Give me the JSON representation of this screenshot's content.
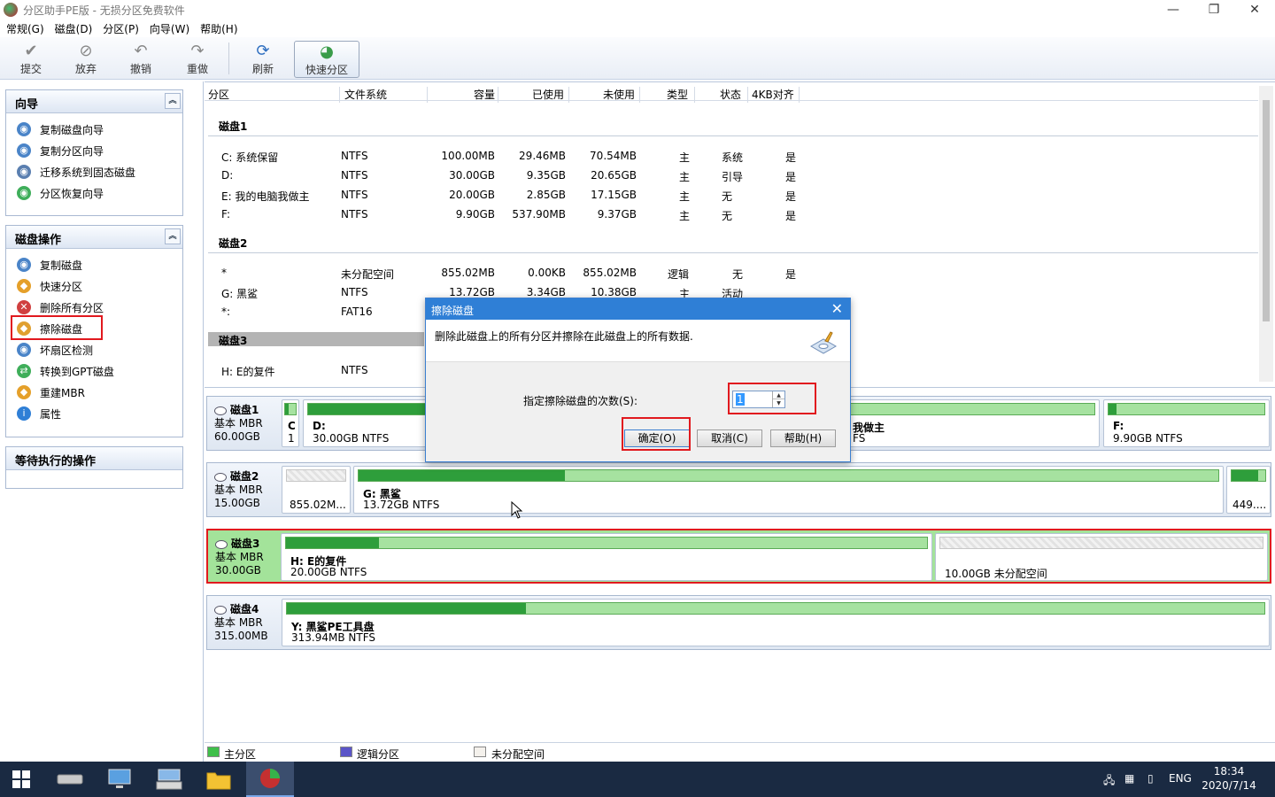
{
  "window": {
    "title": "分区助手PE版 - 无损分区免费软件"
  },
  "menu": [
    "常规(G)",
    "磁盘(D)",
    "分区(P)",
    "向导(W)",
    "帮助(H)"
  ],
  "toolbar": {
    "commit": "提交",
    "discard": "放弃",
    "undo": "撤销",
    "redo": "重做",
    "refresh": "刷新",
    "quick": "快速分区"
  },
  "left": {
    "wizard": {
      "title": "向导",
      "items": [
        "复制磁盘向导",
        "复制分区向导",
        "迁移系统到固态磁盘",
        "分区恢复向导"
      ]
    },
    "diskops": {
      "title": "磁盘操作",
      "items": [
        "复制磁盘",
        "快速分区",
        "删除所有分区",
        "擦除磁盘",
        "坏扇区检测",
        "转换到GPT磁盘",
        "重建MBR",
        "属性"
      ]
    },
    "pending": {
      "title": "等待执行的操作"
    }
  },
  "grid": {
    "headers": [
      "分区",
      "文件系统",
      "容量",
      "已使用",
      "未使用",
      "类型",
      "状态",
      "4KB对齐"
    ],
    "disk1": {
      "label": "磁盘1",
      "rows": [
        [
          "C: 系统保留",
          "NTFS",
          "100.00MB",
          "29.46MB",
          "70.54MB",
          "主",
          "系统",
          "是"
        ],
        [
          "D:",
          "NTFS",
          "30.00GB",
          "9.35GB",
          "20.65GB",
          "主",
          "引导",
          "是"
        ],
        [
          "E: 我的电脑我做主",
          "NTFS",
          "20.00GB",
          "2.85GB",
          "17.15GB",
          "主",
          "无",
          "是"
        ],
        [
          "F:",
          "NTFS",
          "9.90GB",
          "537.90MB",
          "9.37GB",
          "主",
          "无",
          "是"
        ]
      ]
    },
    "disk2": {
      "label": "磁盘2",
      "rows": [
        [
          "*",
          "未分配空间",
          "855.02MB",
          "0.00KB",
          "855.02MB",
          "逻辑",
          "无",
          "是"
        ],
        [
          "G: 黑鲨",
          "NTFS",
          "13.72GB",
          "3.34GB",
          "10.38GB",
          "主",
          "活动",
          ""
        ],
        [
          "*:",
          "FAT16",
          "",
          "",
          "",
          "",
          "",
          ""
        ]
      ]
    },
    "disk3": {
      "label": "磁盘3",
      "rows": [
        [
          "H: E的复件",
          "NTFS",
          "",
          "",
          "",
          "",
          "",
          ""
        ]
      ]
    }
  },
  "maps": {
    "d1": {
      "name": "磁盘1",
      "type": "基本 MBR",
      "size": "60.00GB",
      "p0": {
        "name": "C",
        "size": "1"
      },
      "p1": {
        "name": "D:",
        "size": "30.00GB NTFS"
      },
      "p2": {
        "name": "我做主",
        "size": "FS"
      },
      "p3": {
        "name": "F:",
        "size": "9.90GB NTFS"
      }
    },
    "d2": {
      "name": "磁盘2",
      "type": "基本 MBR",
      "size": "15.00GB",
      "p0": {
        "size": "855.02M..."
      },
      "p1": {
        "name": "G: 黑鲨",
        "size": "13.72GB NTFS"
      },
      "p2": {
        "size": "449...."
      }
    },
    "d3": {
      "name": "磁盘3",
      "type": "基本 MBR",
      "size": "30.00GB",
      "p0": {
        "name": "H: E的复件",
        "size": "20.00GB NTFS"
      },
      "p1": {
        "size": "10.00GB 未分配空间"
      }
    },
    "d4": {
      "name": "磁盘4",
      "type": "基本 MBR",
      "size": "315.00MB",
      "p0": {
        "name": "Y: 黑鲨PE工具盘",
        "size": "313.94MB NTFS"
      }
    }
  },
  "legend": {
    "primary": "主分区",
    "logical": "逻辑分区",
    "unalloc": "未分配空间"
  },
  "dialog": {
    "title": "擦除磁盘",
    "desc": "删除此磁盘上的所有分区并擦除在此磁盘上的所有数据.",
    "label": "指定擦除磁盘的次数(S):",
    "value": "1",
    "ok": "确定(O)",
    "cancel": "取消(C)",
    "help": "帮助(H)"
  },
  "tray": {
    "lang": "ENG",
    "time": "18:34",
    "date": "2020/7/14"
  },
  "colors": {
    "accent": "#2f7fd6",
    "primary": "#2e9e3b",
    "highlight": "#e1191e"
  }
}
